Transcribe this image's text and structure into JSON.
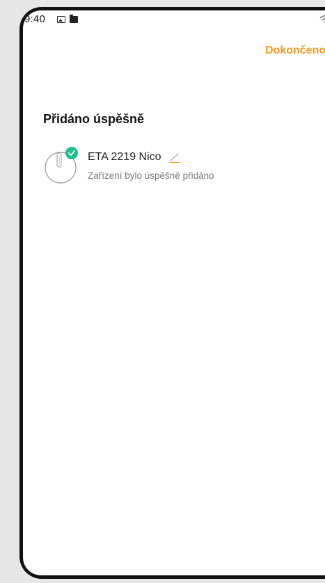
{
  "status_bar": {
    "time": "9:40",
    "icons": [
      "image-icon",
      "folder-icon",
      "wifi-icon",
      "signal-icon"
    ]
  },
  "header": {
    "done_label": "Dokončeno"
  },
  "page": {
    "title": "Přidáno úspěšně"
  },
  "device": {
    "name": "ETA 2219 Nico",
    "status": "Zařízení bylo úspěšně přidáno",
    "icon": "robot-vacuum-icon",
    "badge": "check-badge-icon",
    "edit_icon": "edit-pencil-icon"
  },
  "colors": {
    "accent": "#f59a25",
    "success": "#1fbf8f",
    "muted_text": "#7a7a7a",
    "background": "#e6e6e6"
  }
}
